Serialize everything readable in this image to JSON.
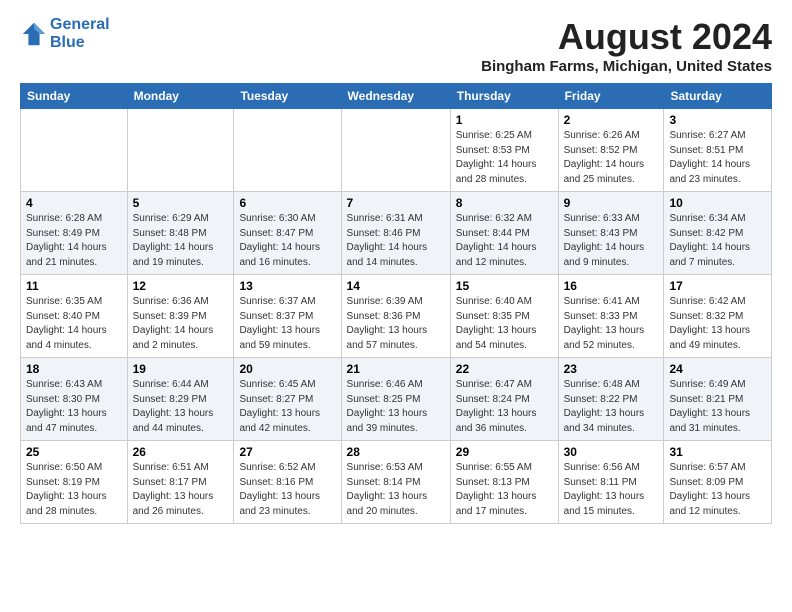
{
  "header": {
    "logo_line1": "General",
    "logo_line2": "Blue",
    "main_title": "August 2024",
    "subtitle": "Bingham Farms, Michigan, United States"
  },
  "calendar": {
    "days_of_week": [
      "Sunday",
      "Monday",
      "Tuesday",
      "Wednesday",
      "Thursday",
      "Friday",
      "Saturday"
    ],
    "weeks": [
      {
        "row_class": "row-odd",
        "days": [
          {
            "num": "",
            "info": ""
          },
          {
            "num": "",
            "info": ""
          },
          {
            "num": "",
            "info": ""
          },
          {
            "num": "",
            "info": ""
          },
          {
            "num": "1",
            "info": "Sunrise: 6:25 AM\nSunset: 8:53 PM\nDaylight: 14 hours\nand 28 minutes."
          },
          {
            "num": "2",
            "info": "Sunrise: 6:26 AM\nSunset: 8:52 PM\nDaylight: 14 hours\nand 25 minutes."
          },
          {
            "num": "3",
            "info": "Sunrise: 6:27 AM\nSunset: 8:51 PM\nDaylight: 14 hours\nand 23 minutes."
          }
        ]
      },
      {
        "row_class": "row-even",
        "days": [
          {
            "num": "4",
            "info": "Sunrise: 6:28 AM\nSunset: 8:49 PM\nDaylight: 14 hours\nand 21 minutes."
          },
          {
            "num": "5",
            "info": "Sunrise: 6:29 AM\nSunset: 8:48 PM\nDaylight: 14 hours\nand 19 minutes."
          },
          {
            "num": "6",
            "info": "Sunrise: 6:30 AM\nSunset: 8:47 PM\nDaylight: 14 hours\nand 16 minutes."
          },
          {
            "num": "7",
            "info": "Sunrise: 6:31 AM\nSunset: 8:46 PM\nDaylight: 14 hours\nand 14 minutes."
          },
          {
            "num": "8",
            "info": "Sunrise: 6:32 AM\nSunset: 8:44 PM\nDaylight: 14 hours\nand 12 minutes."
          },
          {
            "num": "9",
            "info": "Sunrise: 6:33 AM\nSunset: 8:43 PM\nDaylight: 14 hours\nand 9 minutes."
          },
          {
            "num": "10",
            "info": "Sunrise: 6:34 AM\nSunset: 8:42 PM\nDaylight: 14 hours\nand 7 minutes."
          }
        ]
      },
      {
        "row_class": "row-odd",
        "days": [
          {
            "num": "11",
            "info": "Sunrise: 6:35 AM\nSunset: 8:40 PM\nDaylight: 14 hours\nand 4 minutes."
          },
          {
            "num": "12",
            "info": "Sunrise: 6:36 AM\nSunset: 8:39 PM\nDaylight: 14 hours\nand 2 minutes."
          },
          {
            "num": "13",
            "info": "Sunrise: 6:37 AM\nSunset: 8:37 PM\nDaylight: 13 hours\nand 59 minutes."
          },
          {
            "num": "14",
            "info": "Sunrise: 6:39 AM\nSunset: 8:36 PM\nDaylight: 13 hours\nand 57 minutes."
          },
          {
            "num": "15",
            "info": "Sunrise: 6:40 AM\nSunset: 8:35 PM\nDaylight: 13 hours\nand 54 minutes."
          },
          {
            "num": "16",
            "info": "Sunrise: 6:41 AM\nSunset: 8:33 PM\nDaylight: 13 hours\nand 52 minutes."
          },
          {
            "num": "17",
            "info": "Sunrise: 6:42 AM\nSunset: 8:32 PM\nDaylight: 13 hours\nand 49 minutes."
          }
        ]
      },
      {
        "row_class": "row-even",
        "days": [
          {
            "num": "18",
            "info": "Sunrise: 6:43 AM\nSunset: 8:30 PM\nDaylight: 13 hours\nand 47 minutes."
          },
          {
            "num": "19",
            "info": "Sunrise: 6:44 AM\nSunset: 8:29 PM\nDaylight: 13 hours\nand 44 minutes."
          },
          {
            "num": "20",
            "info": "Sunrise: 6:45 AM\nSunset: 8:27 PM\nDaylight: 13 hours\nand 42 minutes."
          },
          {
            "num": "21",
            "info": "Sunrise: 6:46 AM\nSunset: 8:25 PM\nDaylight: 13 hours\nand 39 minutes."
          },
          {
            "num": "22",
            "info": "Sunrise: 6:47 AM\nSunset: 8:24 PM\nDaylight: 13 hours\nand 36 minutes."
          },
          {
            "num": "23",
            "info": "Sunrise: 6:48 AM\nSunset: 8:22 PM\nDaylight: 13 hours\nand 34 minutes."
          },
          {
            "num": "24",
            "info": "Sunrise: 6:49 AM\nSunset: 8:21 PM\nDaylight: 13 hours\nand 31 minutes."
          }
        ]
      },
      {
        "row_class": "row-odd",
        "days": [
          {
            "num": "25",
            "info": "Sunrise: 6:50 AM\nSunset: 8:19 PM\nDaylight: 13 hours\nand 28 minutes."
          },
          {
            "num": "26",
            "info": "Sunrise: 6:51 AM\nSunset: 8:17 PM\nDaylight: 13 hours\nand 26 minutes."
          },
          {
            "num": "27",
            "info": "Sunrise: 6:52 AM\nSunset: 8:16 PM\nDaylight: 13 hours\nand 23 minutes."
          },
          {
            "num": "28",
            "info": "Sunrise: 6:53 AM\nSunset: 8:14 PM\nDaylight: 13 hours\nand 20 minutes."
          },
          {
            "num": "29",
            "info": "Sunrise: 6:55 AM\nSunset: 8:13 PM\nDaylight: 13 hours\nand 17 minutes."
          },
          {
            "num": "30",
            "info": "Sunrise: 6:56 AM\nSunset: 8:11 PM\nDaylight: 13 hours\nand 15 minutes."
          },
          {
            "num": "31",
            "info": "Sunrise: 6:57 AM\nSunset: 8:09 PM\nDaylight: 13 hours\nand 12 minutes."
          }
        ]
      }
    ]
  }
}
